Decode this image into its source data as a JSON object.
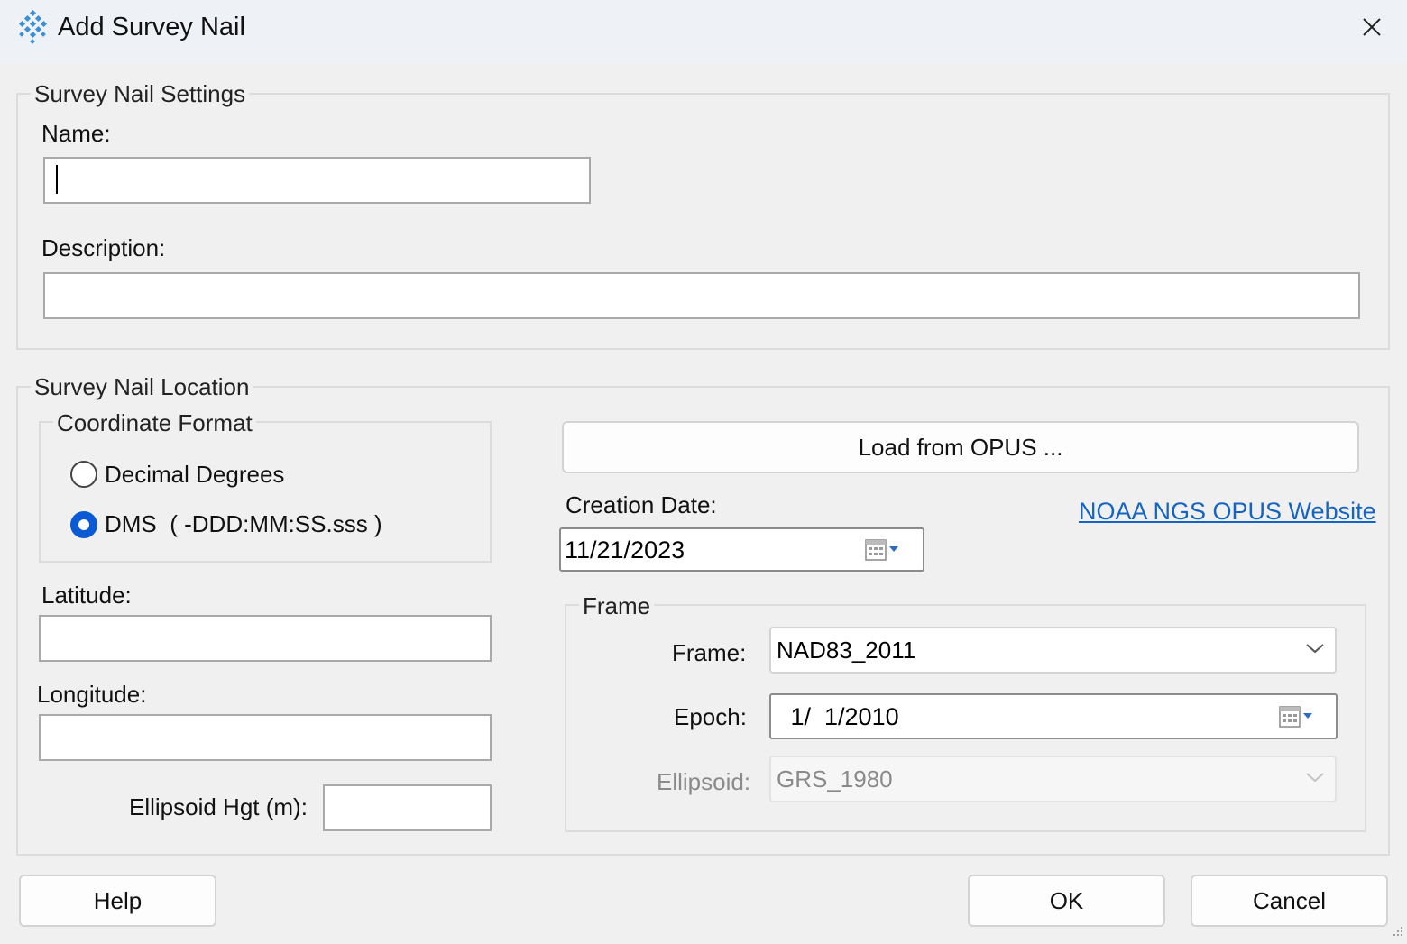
{
  "window": {
    "title": "Add Survey Nail",
    "close_icon": "close-icon",
    "app_icon": "survey-nail-icon"
  },
  "settings_group": {
    "label": "Survey Nail Settings",
    "name_label": "Name:",
    "name_value": "",
    "description_label": "Description:",
    "description_value": ""
  },
  "location_group": {
    "label": "Survey Nail Location",
    "coordinate_format": {
      "label": "Coordinate Format",
      "options": [
        {
          "label": "Decimal Degrees",
          "selected": false
        },
        {
          "label": "DMS  ( -DDD:MM:SS.sss )",
          "selected": true
        }
      ]
    },
    "latitude_label": "Latitude:",
    "latitude_value": "",
    "longitude_label": "Longitude:",
    "longitude_value": "",
    "ellipsoid_hgt_label": "Ellipsoid Hgt (m):",
    "ellipsoid_hgt_value": "",
    "load_opus_button": "Load from OPUS ...",
    "creation_date_label": "Creation Date:",
    "creation_date_value": "11/21/2023",
    "opus_link": "NOAA NGS OPUS Website",
    "frame_group": {
      "label": "Frame",
      "frame_label": "Frame:",
      "frame_value": "NAD83_2011",
      "epoch_label": "Epoch:",
      "epoch_value": " 1/  1/2010",
      "ellipsoid_label": "Ellipsoid:",
      "ellipsoid_value": "GRS_1980",
      "ellipsoid_enabled": false
    }
  },
  "footer": {
    "help_button": "Help",
    "ok_button": "OK",
    "cancel_button": "Cancel"
  },
  "colors": {
    "accent": "#0a5bd3",
    "link": "#1565c0",
    "background": "#f0f0f0",
    "titlebar": "#eef2f6"
  }
}
